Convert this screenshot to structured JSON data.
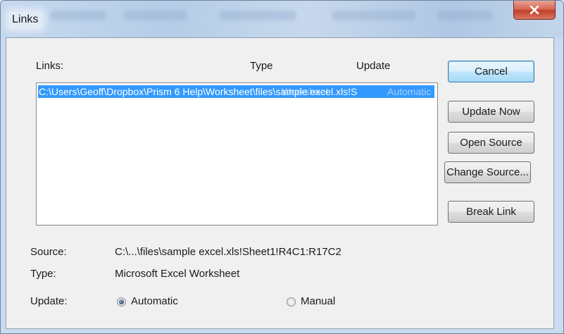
{
  "window": {
    "title": "Links",
    "close_glyph": "X"
  },
  "list": {
    "header_links": "Links:",
    "header_type": "Type",
    "header_update": "Update",
    "selected_row": {
      "link": "C:\\Users\\Geoff\\Dropbox\\Prism 6 Help\\Worksheet\\files\\sample excel.xls!S",
      "type": "Worksheet",
      "update": "Automatic"
    }
  },
  "buttons": {
    "cancel": "Cancel",
    "update_now": "Update Now",
    "open_source": "Open Source",
    "change_source": "Change Source...",
    "break_link": "Break Link"
  },
  "details": {
    "source_label": "Source:",
    "source_value": "C:\\...\\files\\sample excel.xls!Sheet1!R4C1:R17C2",
    "type_label": "Type:",
    "type_value": "Microsoft Excel Worksheet",
    "update_label": "Update:",
    "update_options": {
      "automatic": "Automatic",
      "manual": "Manual"
    },
    "update_selected": "Automatic"
  },
  "colors": {
    "selection": "#3399ff",
    "default_button_border": "#3c7fb1"
  },
  "icons": {
    "close": "close-icon",
    "radio": "radio-button"
  }
}
